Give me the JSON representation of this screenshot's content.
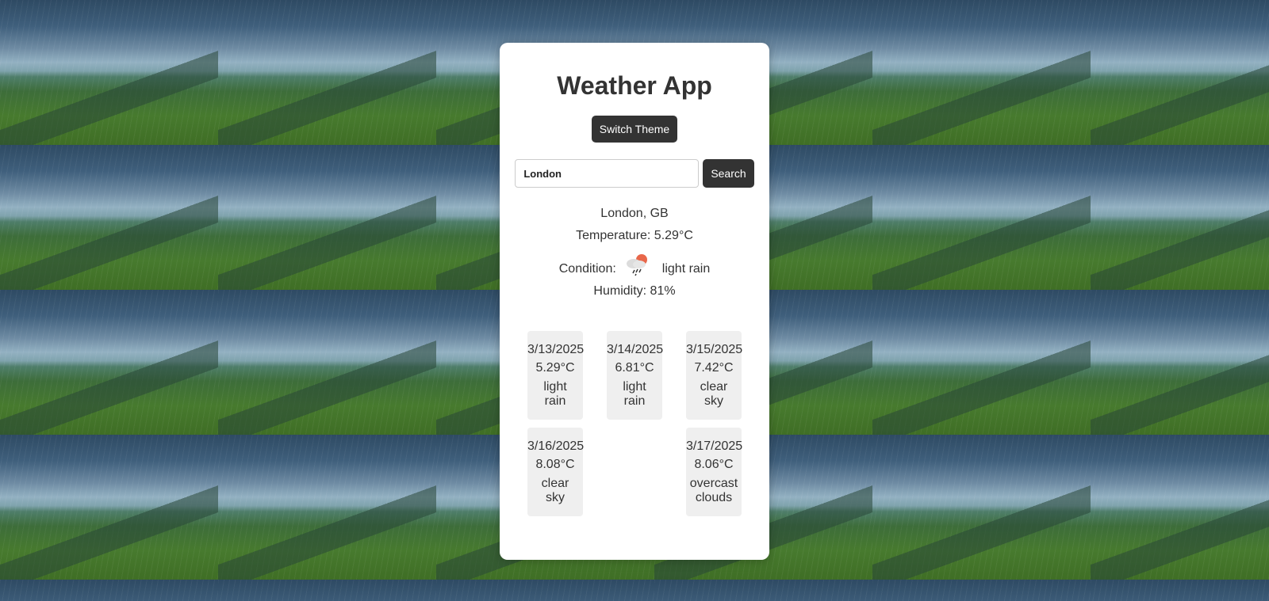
{
  "app": {
    "title": "Weather App",
    "theme_button": "Switch Theme"
  },
  "search": {
    "value": "London",
    "placeholder": "",
    "button": "Search"
  },
  "current": {
    "location": "London, GB",
    "temperature_label": "Temperature: 5.29°C",
    "condition_label": "Condition:",
    "condition_icon": "light-rain-icon",
    "condition_text": "light rain",
    "humidity_label": "Humidity: 81%"
  },
  "forecast": [
    {
      "date": "3/13/2025",
      "temp": "5.29°C",
      "cond1": "light",
      "cond2": "rain"
    },
    {
      "date": "3/14/2025",
      "temp": "6.81°C",
      "cond1": "light",
      "cond2": "rain"
    },
    {
      "date": "3/15/2025",
      "temp": "7.42°C",
      "cond1": "clear",
      "cond2": "sky"
    },
    {
      "date": "3/16/2025",
      "temp": "8.08°C",
      "cond1": "clear",
      "cond2": "sky"
    },
    {
      "date": "3/17/2025",
      "temp": "8.06°C",
      "cond1": "overcast",
      "cond2": "clouds"
    }
  ],
  "colors": {
    "button_bg": "#333333",
    "card_bg": "#ffffff",
    "forecast_bg": "#efefef",
    "icon_sun": "#e8674a"
  }
}
